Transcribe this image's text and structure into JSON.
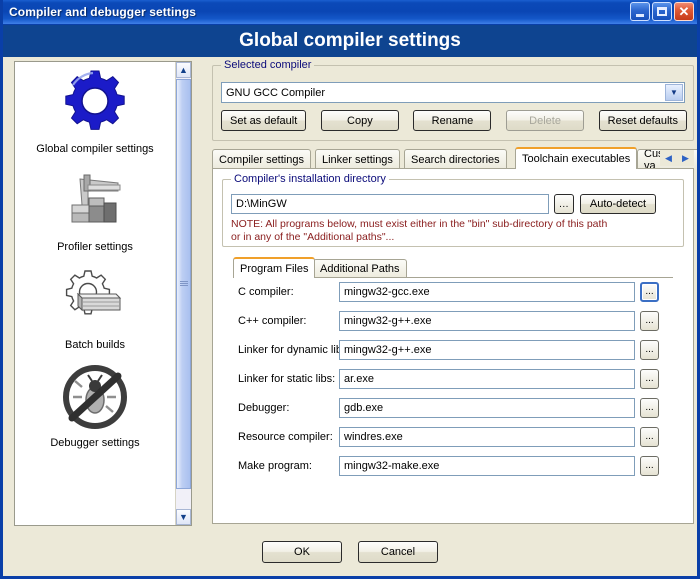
{
  "window": {
    "title": "Compiler and debugger settings",
    "buttons": {
      "minimize": "minimize",
      "maximize": "maximize",
      "close": "✕"
    }
  },
  "header": {
    "title": "Global compiler settings"
  },
  "sidebar": {
    "items": [
      {
        "label": "Global compiler settings",
        "icon": "blue-gear-icon",
        "selected": true
      },
      {
        "label": "Profiler settings",
        "icon": "caliper-icon",
        "selected": false
      },
      {
        "label": "Batch builds",
        "icon": "gear-stack-icon",
        "selected": false
      },
      {
        "label": "Debugger settings",
        "icon": "no-bug-icon",
        "selected": false
      }
    ],
    "scrollbar": {
      "up_arrow": "▲",
      "down_arrow": "▼"
    }
  },
  "selected_compiler": {
    "group_title": "Selected compiler",
    "combo_value": "GNU GCC Compiler",
    "combo_arrow": "▼",
    "buttons": [
      {
        "label": "Set as default",
        "disabled": false
      },
      {
        "label": "Copy",
        "disabled": false
      },
      {
        "label": "Rename",
        "disabled": false
      },
      {
        "label": "Delete",
        "disabled": true
      },
      {
        "label": "Reset defaults",
        "disabled": false
      }
    ]
  },
  "tabs": {
    "items": [
      {
        "label": "Compiler settings",
        "active": false
      },
      {
        "label": "Linker settings",
        "active": false
      },
      {
        "label": "Search directories",
        "active": false
      },
      {
        "label": "Toolchain executables",
        "active": true
      },
      {
        "label": "Custom va",
        "active": false,
        "clipped": true
      }
    ],
    "scroll_left": "◀",
    "scroll_right": "▶"
  },
  "install_dir": {
    "group_title": "Compiler's installation directory",
    "path_value": "D:\\MinGW",
    "browse_label": "...",
    "autodetect_label": "Auto-detect",
    "note_line1": "NOTE: All programs below, must exist either in the \"bin\" sub-directory of this path",
    "note_line2": "or in any of the \"Additional paths\"...",
    "note_color": "#8b2020"
  },
  "inner_tabs": {
    "items": [
      {
        "label": "Program Files",
        "active": true
      },
      {
        "label": "Additional Paths",
        "active": false
      }
    ]
  },
  "program_files": {
    "browse_label": "...",
    "fields": [
      {
        "label": "C compiler:",
        "value": "mingw32-gcc.exe",
        "focused": true
      },
      {
        "label": "C++ compiler:",
        "value": "mingw32-g++.exe",
        "focused": false
      },
      {
        "label": "Linker for dynamic libs:",
        "value": "mingw32-g++.exe",
        "focused": false
      },
      {
        "label": "Linker for static libs:",
        "value": "ar.exe",
        "focused": false
      },
      {
        "label": "Debugger:",
        "value": "gdb.exe",
        "focused": false
      },
      {
        "label": "Resource compiler:",
        "value": "windres.exe",
        "focused": false
      },
      {
        "label": "Make program:",
        "value": "mingw32-make.exe",
        "focused": false
      }
    ]
  },
  "footer": {
    "ok_label": "OK",
    "cancel_label": "Cancel"
  },
  "colors": {
    "title_bar_blue": "#0a46b4",
    "header_band": "#0e4490",
    "dialog_face": "#ece9d8",
    "group_label": "#0b0b7a",
    "active_tab_accent": "#f0a02a",
    "note_red": "#8b2020",
    "frame_blue": "#0a3fa8"
  }
}
